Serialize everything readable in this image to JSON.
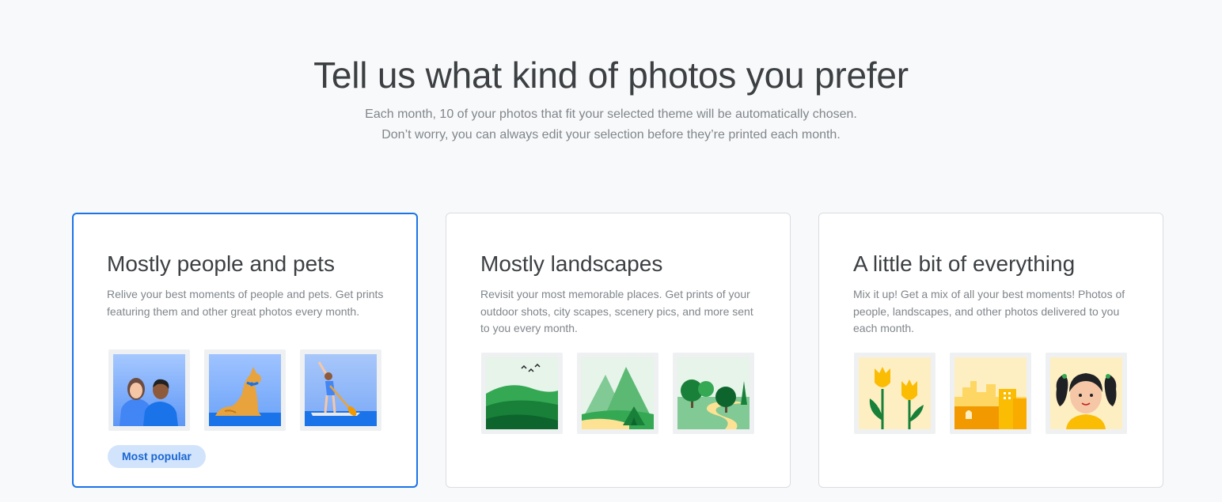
{
  "header": {
    "title": "Tell us what kind of photos you prefer",
    "subtitle_line1": "Each month, 10 of your photos that fit your selected theme will be automatically chosen.",
    "subtitle_line2": "Don’t worry, you can always edit your selection before they’re printed each month."
  },
  "options": [
    {
      "title": "Mostly people and pets",
      "description": "Relive your best moments of people and pets. Get prints featuring them and other great photos every month.",
      "selected": true,
      "badge": "Most popular",
      "thumbnails": [
        "couple-illustration",
        "dog-illustration",
        "paddleboarder-illustration"
      ]
    },
    {
      "title": "Mostly landscapes",
      "description": "Revisit your most memorable places. Get prints of your outdoor shots, city scapes, scenery pics, and more sent to you every month.",
      "selected": false,
      "thumbnails": [
        "hills-illustration",
        "mountains-tent-illustration",
        "forest-path-illustration"
      ]
    },
    {
      "title": "A little bit of everything",
      "description": "Mix it up! Get a mix of all your best moments! Photos of people, landscapes, and other photos delivered to you each month.",
      "selected": false,
      "thumbnails": [
        "tulips-illustration",
        "city-illustration",
        "girl-portrait-illustration"
      ]
    }
  ],
  "colors": {
    "accent": "#1a73e8",
    "badge_bg": "#d2e3fc",
    "badge_text": "#1967d2",
    "background": "#f8f9fa"
  }
}
